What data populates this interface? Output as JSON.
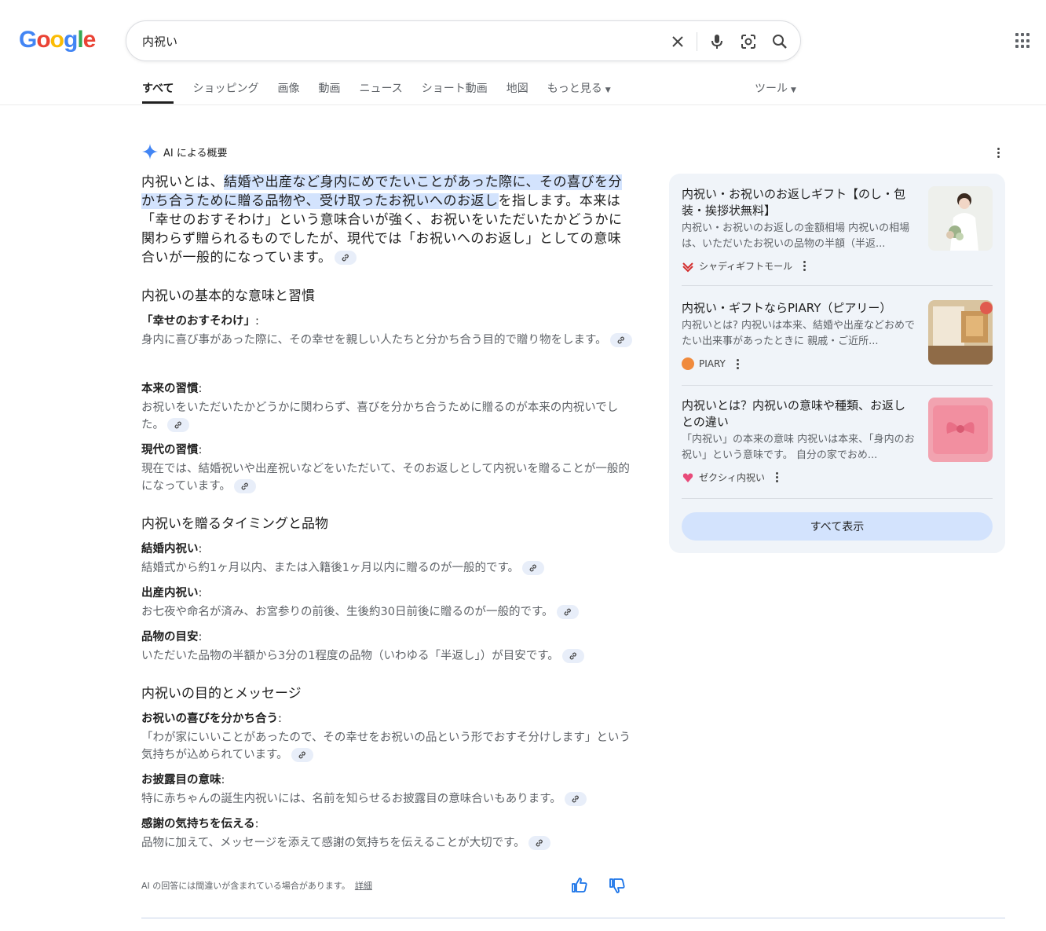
{
  "header": {
    "logo_letters": [
      "G",
      "o",
      "o",
      "g",
      "l",
      "e"
    ],
    "query": "内祝い",
    "icons": [
      "clear-icon",
      "mic-icon",
      "lens-icon",
      "search-icon",
      "apps-icon"
    ]
  },
  "tabs": [
    {
      "label": "すべて"
    },
    {
      "label": "ショッピング"
    },
    {
      "label": "画像"
    },
    {
      "label": "動画"
    },
    {
      "label": "ニュース"
    },
    {
      "label": "ショート動画"
    },
    {
      "label": "地図"
    },
    {
      "label": "もっと見る"
    }
  ],
  "tools_label": "ツール",
  "ai": {
    "heading": "AI による概要",
    "lead_pre": "内祝いとは、",
    "lead_highlight": "結婚や出産など身内にめでたいことがあった際に、その喜びを分かち合うために贈る品物や、受け取ったお祝いへのお返し",
    "lead_post": "を指します。本来は「幸せのおすそわけ」という意味合いが強く、お祝いをいただいたかどうかに関わらず贈られるものでしたが、現代では「お祝いへのお返し」としての意味合いが一般的になっています。",
    "sections": [
      {
        "title": "内祝いの基本的な意味と習慣",
        "items": [
          {
            "term": "「幸せのおすそわけ」",
            "desc": "身内に喜び事があった際に、その幸せを親しい人たちと分かち合う目的で贈り物をします。"
          },
          {
            "term": "本来の習慣",
            "desc": "お祝いをいただいたかどうかに関わらず、喜びを分かち合うために贈るのが本来の内祝いでした。"
          },
          {
            "term": "現代の習慣",
            "desc": "現在では、結婚祝いや出産祝いなどをいただいて、そのお返しとして内祝いを贈ることが一般的になっています。"
          }
        ]
      },
      {
        "title": "内祝いを贈るタイミングと品物",
        "items": [
          {
            "term": "結婚内祝い",
            "desc": "結婚式から約1ヶ月以内、または入籍後1ヶ月以内に贈るのが一般的です。"
          },
          {
            "term": "出産内祝い",
            "desc": "お七夜や命名が済み、お宮参りの前後、生後約30日前後に贈るのが一般的です。"
          },
          {
            "term": "品物の目安",
            "desc": "いただいた品物の半額から3分の1程度の品物（いわゆる「半返し」）が目安です。"
          }
        ]
      },
      {
        "title": "内祝いの目的とメッセージ",
        "items": [
          {
            "term": "お祝いの喜びを分かち合う",
            "desc": "「わが家にいいことがあったので、その幸せをお祝いの品という形でおすそ分けします」という気持ちが込められています。"
          },
          {
            "term": "お披露目の意味",
            "desc": "特に赤ちゃんの誕生内祝いには、名前を知らせるお披露目の意味合いもあります。"
          },
          {
            "term": "感謝の気持ちを伝える",
            "desc": "品物に加えて、メッセージを添えて感謝の気持ちを伝えることが大切です。"
          }
        ]
      }
    ],
    "disclaimer": "AI の回答には間違いが含まれている場合があります。",
    "details_link": "詳細"
  },
  "sources": [
    {
      "title": "内祝い・お祝いのお返しギフト【のし・包装・挨拶状無料】",
      "snippet": "内祝い・お祝いのお返しの金額相場 内祝いの相場は、いただいたお祝いの品物の半額（半返...",
      "site": "シャディギフトモール",
      "favicon_color": "#d32f2f",
      "image_colors": [
        "#e9ece6",
        "#f7f5f2"
      ]
    },
    {
      "title": "内祝い・ギフトならPIARY（ピアリー）",
      "snippet": "内祝いとは? 内祝いは本来、結婚や出産などおめでたい出来事があったときに 親戚・ご近所...",
      "site": "PIARY",
      "favicon_color": "#f08a3c",
      "image_colors": [
        "#c9a97a",
        "#e7d6b8"
      ]
    },
    {
      "title": "内祝いとは？内祝いの意味や種類、お返しとの違い",
      "snippet": "「内祝い」の本来の意味 内祝いは本来、「身内のお祝い」という意味です。 自分の家でおめ...",
      "site": "ゼクシィ内祝い",
      "favicon_color": "#e84b7a",
      "image_colors": [
        "#f28fa0",
        "#f6b3bf"
      ]
    }
  ],
  "show_all_label": "すべて表示",
  "colors": {
    "accent": "#1a73e8",
    "highlight": "#d3e3fd",
    "panel_bg": "#f0f4f9"
  }
}
